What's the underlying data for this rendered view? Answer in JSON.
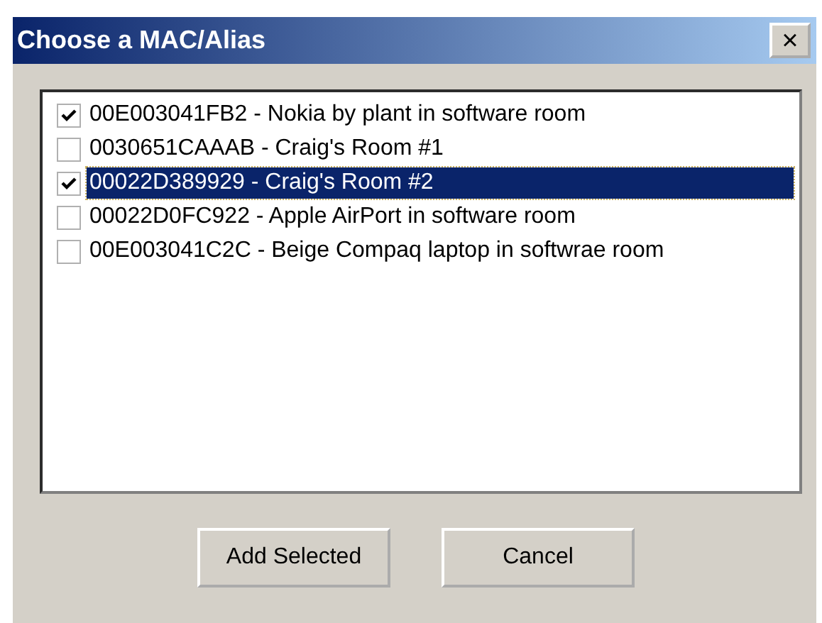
{
  "window": {
    "title": "Choose a MAC/Alias",
    "close": "×"
  },
  "items": [
    {
      "label": "00E003041FB2 - Nokia by plant in software room",
      "checked": true,
      "selected": false
    },
    {
      "label": "0030651CAAAB - Craig's Room #1",
      "checked": false,
      "selected": false
    },
    {
      "label": "00022D389929 - Craig's Room #2",
      "checked": true,
      "selected": true
    },
    {
      "label": "00022D0FC922 - Apple AirPort in software room",
      "checked": false,
      "selected": false
    },
    {
      "label": "00E003041C2C - Beige Compaq laptop in softwrae room",
      "checked": false,
      "selected": false
    }
  ],
  "buttons": [
    "Add Selected",
    "Cancel"
  ]
}
